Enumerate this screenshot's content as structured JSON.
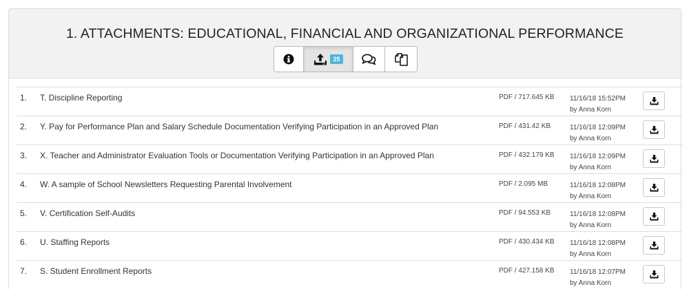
{
  "panel": {
    "title": "1. ATTACHMENTS: EDUCATIONAL, FINANCIAL AND ORGANIZATIONAL PERFORMANCE",
    "tabs": [
      {
        "icon": "info-icon",
        "active": false
      },
      {
        "icon": "upload-icon",
        "active": true,
        "badge": "25"
      },
      {
        "icon": "comments-icon",
        "active": false
      },
      {
        "icon": "copy-icon",
        "active": false
      }
    ]
  },
  "attachments": [
    {
      "num": "1.",
      "title": "T. Discipline Reporting",
      "size": "PDF / 717.645 KB",
      "date": "11/16/18 15:52PM",
      "by": "by Anna Korn"
    },
    {
      "num": "2.",
      "title": "Y. Pay for Performance Plan and Salary Schedule Documentation Verifying Participation in an Approved Plan",
      "size": "PDF / 431.42 KB",
      "date": "11/16/18 12:09PM",
      "by": "by Anna Korn"
    },
    {
      "num": "3.",
      "title": "X. Teacher and Administrator Evaluation Tools or Documentation Verifying Participation in an Approved Plan",
      "size": "PDF / 432.179 KB",
      "date": "11/16/18 12:09PM",
      "by": "by Anna Korn"
    },
    {
      "num": "4.",
      "title": "W. A sample of School Newsletters Requesting Parental Involvement",
      "size": "PDF / 2.095 MB",
      "date": "11/16/18 12:08PM",
      "by": "by Anna Korn"
    },
    {
      "num": "5.",
      "title": "V. Certification Self-Audits",
      "size": "PDF / 94.553 KB",
      "date": "11/16/18 12:08PM",
      "by": "by Anna Korn"
    },
    {
      "num": "6.",
      "title": "U. Staffing Reports",
      "size": "PDF / 430.434 KB",
      "date": "11/16/18 12:08PM",
      "by": "by Anna Korn"
    },
    {
      "num": "7.",
      "title": "S. Student Enrollment Reports",
      "size": "PDF / 427.158 KB",
      "date": "11/16/18 12:07PM",
      "by": "by Anna Korn"
    }
  ]
}
